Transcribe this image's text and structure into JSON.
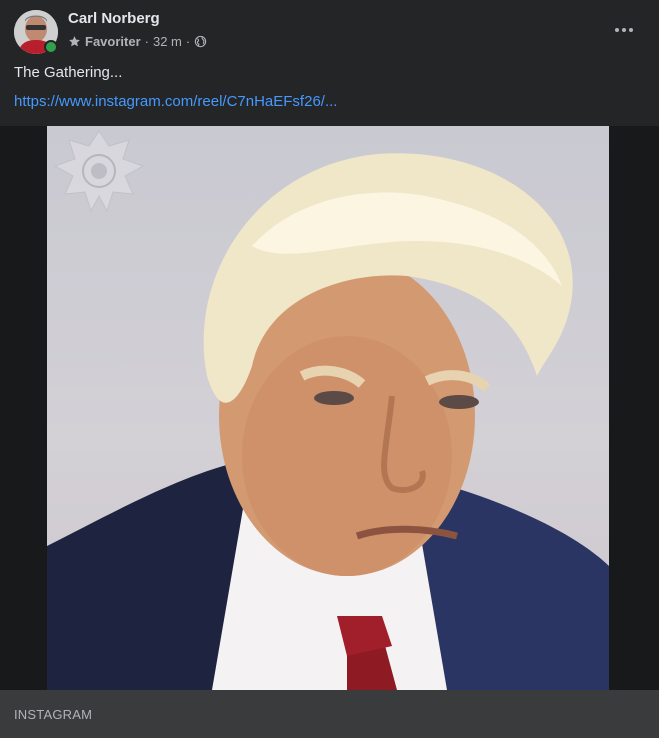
{
  "post": {
    "author": "Carl Norberg",
    "audience_label": "Favoriter",
    "time": "32 m",
    "separator": "·",
    "text": "The Gathering...",
    "link": "https://www.instagram.com/reel/C7nHaEFsf26/...",
    "source": "INSTAGRAM"
  },
  "icons": {
    "more": "more-options-icon",
    "star": "star-icon",
    "globe": "globe-icon"
  },
  "colors": {
    "background": "#242526",
    "link": "#4599ff",
    "online": "#31a24c",
    "footer": "#3a3b3c"
  }
}
